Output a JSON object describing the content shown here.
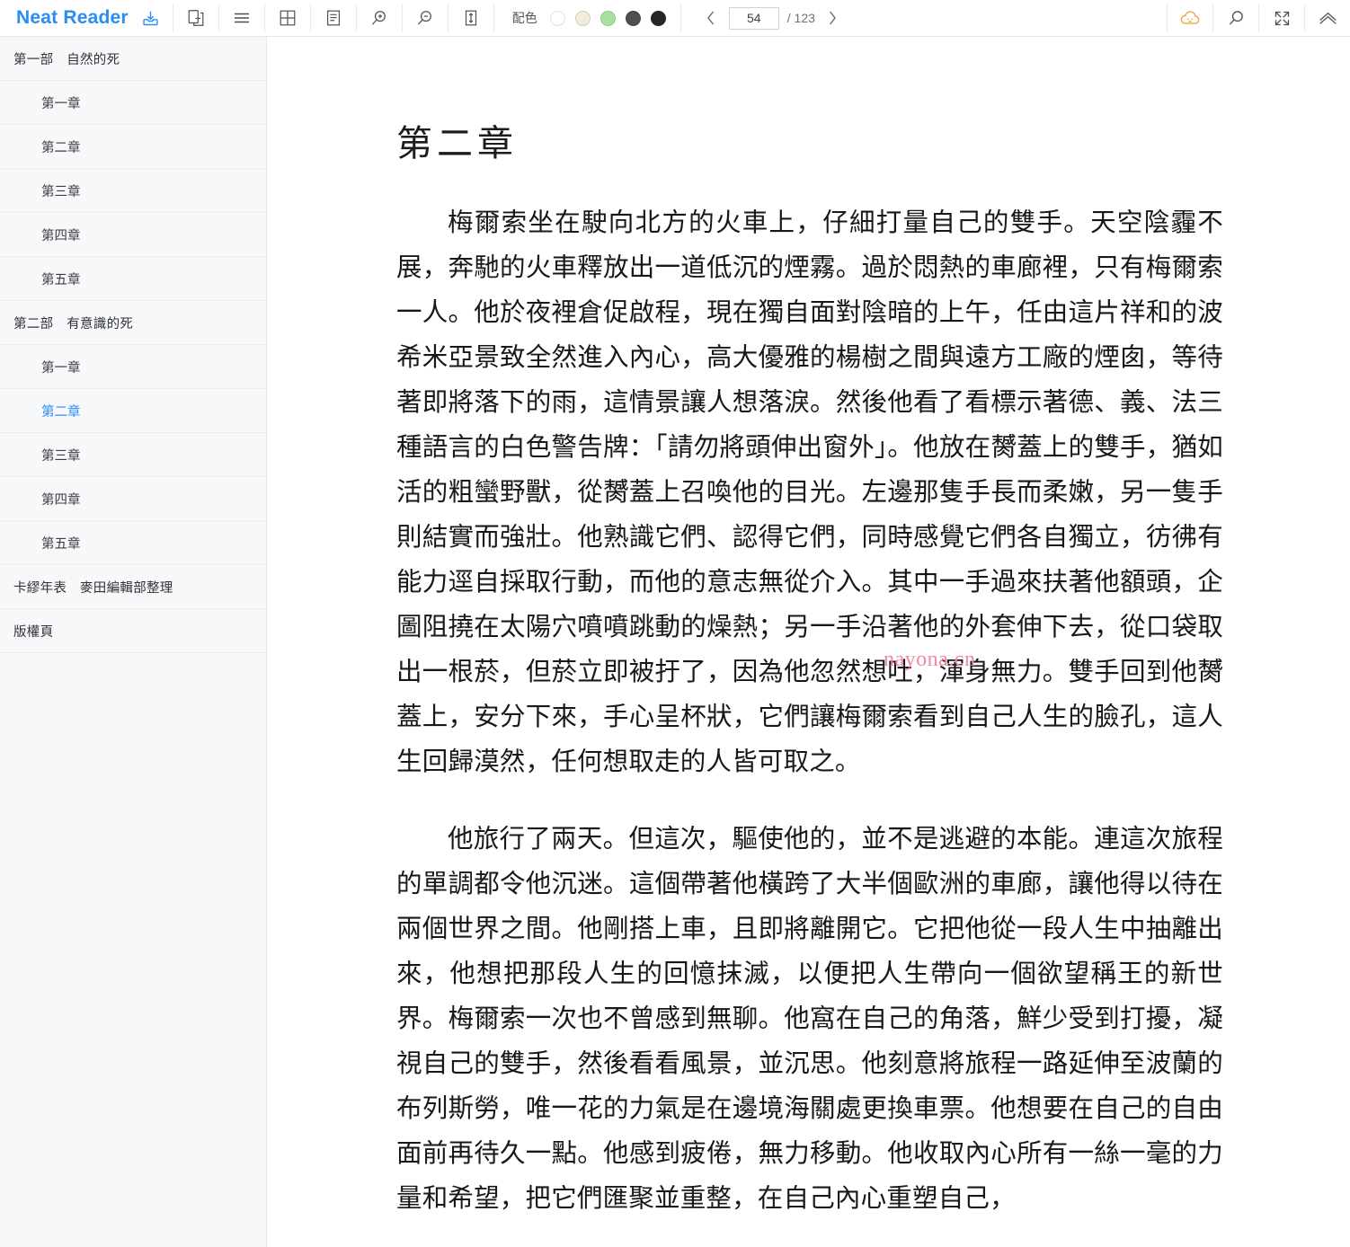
{
  "app": {
    "brand": "Neat Reader",
    "brand_color": "#2a8cf5",
    "save_icon": "save-download-icon"
  },
  "toolbar": {
    "buttons": [
      {
        "name": "two-page-spread-icon",
        "label": "兩頁模式"
      },
      {
        "name": "hamburger-menu-icon",
        "label": "目錄"
      },
      {
        "name": "grid-layout-icon",
        "label": "網格視圖"
      },
      {
        "name": "single-column-icon",
        "label": "單欄視圖"
      },
      {
        "name": "zoom-in-icon",
        "label": "放大"
      },
      {
        "name": "zoom-out-icon",
        "label": "縮小"
      },
      {
        "name": "fit-height-icon",
        "label": "適合高度"
      }
    ],
    "palette": {
      "label": "配色",
      "swatches": [
        {
          "name": "swatch-white",
          "color": "#ffffff",
          "selected": false
        },
        {
          "name": "swatch-cream",
          "color": "#f2ecdc",
          "selected": false
        },
        {
          "name": "swatch-green",
          "color": "#a8e0a0",
          "selected": false
        },
        {
          "name": "swatch-dark-gray",
          "color": "#4b4e52",
          "selected": false
        },
        {
          "name": "swatch-black",
          "color": "#242629",
          "selected": false
        }
      ]
    },
    "pager": {
      "prev_label": "‹",
      "next_label": "›",
      "current_page": "54",
      "total_label": "/ 123"
    },
    "right_buttons": [
      {
        "name": "cloud-sync-icon",
        "label": "雲端同步",
        "color": "#f2a33c"
      },
      {
        "name": "search-icon",
        "label": "搜尋"
      },
      {
        "name": "fullscreen-icon",
        "label": "全螢幕"
      },
      {
        "name": "collapse-up-icon",
        "label": "收起"
      }
    ]
  },
  "sidebar": {
    "items": [
      {
        "label": "第一部　自然的死",
        "level": 0,
        "active": false
      },
      {
        "label": "第一章",
        "level": 1,
        "active": false
      },
      {
        "label": "第二章",
        "level": 1,
        "active": false
      },
      {
        "label": "第三章",
        "level": 1,
        "active": false
      },
      {
        "label": "第四章",
        "level": 1,
        "active": false
      },
      {
        "label": "第五章",
        "level": 1,
        "active": false
      },
      {
        "label": "第二部　有意識的死",
        "level": 0,
        "active": false
      },
      {
        "label": "第一章",
        "level": 1,
        "active": false
      },
      {
        "label": "第二章",
        "level": 1,
        "active": true
      },
      {
        "label": "第三章",
        "level": 1,
        "active": false
      },
      {
        "label": "第四章",
        "level": 1,
        "active": false
      },
      {
        "label": "第五章",
        "level": 1,
        "active": false
      },
      {
        "label": "卡繆年表　麥田編輯部整理",
        "level": 0,
        "active": false
      },
      {
        "label": "版權頁",
        "level": 0,
        "active": false
      }
    ]
  },
  "content": {
    "chapter_title": "第二章",
    "paragraphs": [
      "梅爾索坐在駛向北方的火車上，仔細打量自己的雙手。天空陰霾不展，奔馳的火車釋放出一道低沉的煙霧。過於悶熱的車廊裡，只有梅爾索一人。他於夜裡倉促啟程，現在獨自面對陰暗的上午，任由這片祥和的波希米亞景致全然進入內心，高大優雅的楊樹之間與遠方工廠的煙囱，等待著即將落下的雨，這情景讓人想落淚。然後他看了看標示著德、義、法三種語言的白色警告牌：「請勿將頭伸出窗外」。他放在膥蓋上的雙手，猶如活的粗蠻野獸，從膥蓋上召喚他的目光。左邊那隻手長而柔嫩，另一隻手則結實而強壯。他熟識它們、認得它們，同時感覺它們各自獨立，彷彿有能力逕自採取行動，而他的意志無從介入。其中一手過來扶著他額頭，企圖阻撓在太陽穴噴噴跳動的燥熱；另一手沿著他的外套伸下去，從口袋取出一根菸，但菸立即被扜了，因為他忽然想吐，渾身無力。雙手回到他膥蓋上，安分下來，手心呈杯狀，它們讓梅爾索看到自己人生的臉孔，這人生回歸漠然，任何想取走的人皆可取之。",
      "他旅行了兩天。但這次，驅使他的，並不是逃避的本能。連這次旅程的單調都令他沉迷。這個帶著他橫跨了大半個歐洲的車廊，讓他得以待在兩個世界之間。他剛搭上車，且即將離開它。它把他從一段人生中抽離出來，他想把那段人生的回憶抹滅，以便把人生帶向一個欲望稱王的新世界。梅爾索一次也不曾感到無聊。他窩在自己的角落，鮮少受到打擾，凝視自己的雙手，然後看看風景，並沉思。他刻意將旅程一路延伸至波蘭的布列斯勞，唯一花的力氣是在邊境海關處更換車票。他想要在自己的自由面前再待久一點。他感到疲倦，無力移動。他收取內心所有一絲一毫的力量和希望，把它們匯聚並重整，在自己內心重塑自己，"
    ],
    "watermark": "nayona.cn"
  }
}
